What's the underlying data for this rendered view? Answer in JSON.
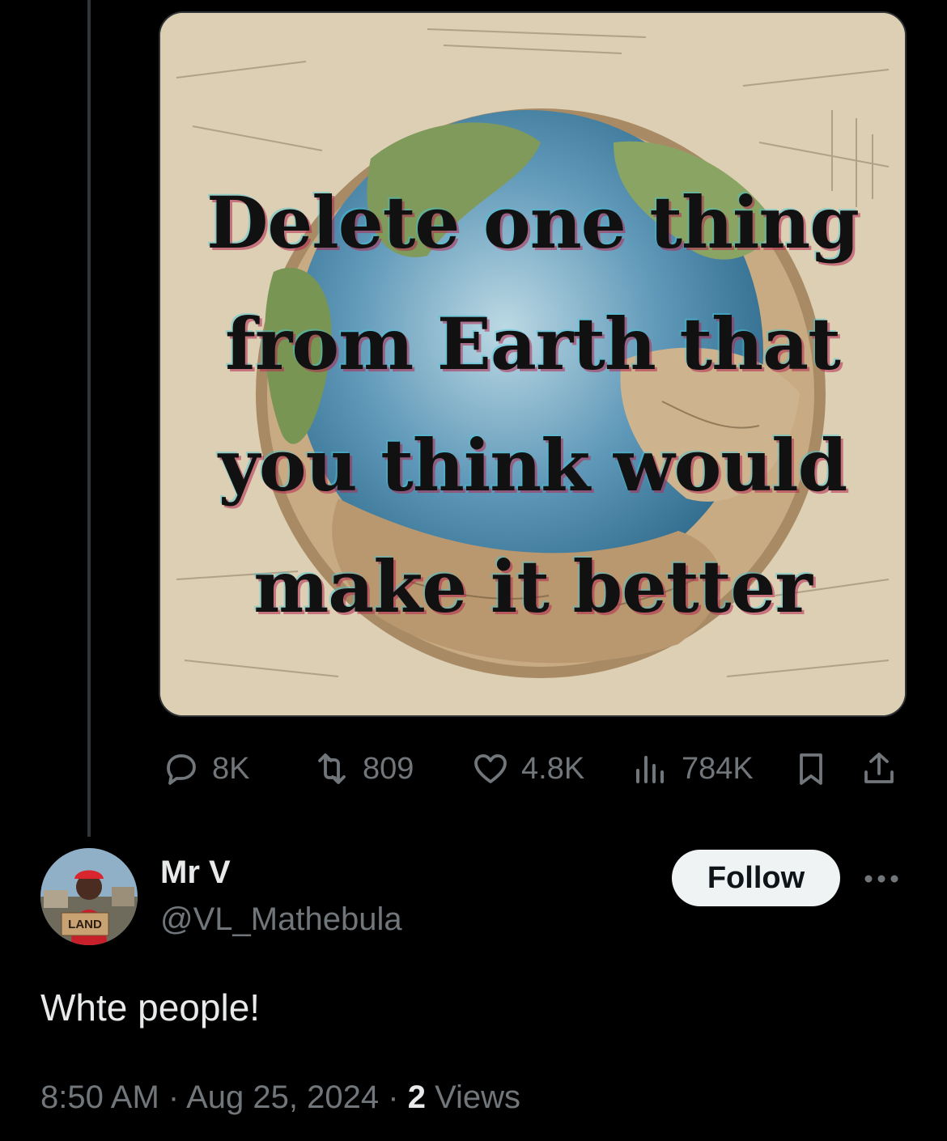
{
  "meme": {
    "lines": [
      "Delete one thing",
      "from Earth that",
      "you think would",
      "make it better"
    ]
  },
  "actions": {
    "replies": "8K",
    "reposts": "809",
    "likes": "4.8K",
    "views": "784K",
    "icons": [
      "reply-icon",
      "repost-icon",
      "like-icon",
      "views-icon",
      "bookmark-icon",
      "share-icon"
    ]
  },
  "author": {
    "name": "Mr V",
    "handle": "@VL_Mathebula",
    "follow_label": "Follow",
    "avatar_sign": "LAND"
  },
  "tweet": {
    "text": "Whte people!"
  },
  "meta": {
    "time": "8:50 AM",
    "date": "Aug 25, 2024",
    "sep": "·",
    "views_count": "2",
    "views_label": "Views"
  },
  "colors": {
    "background": "#000000",
    "text_primary": "#e7e9ea",
    "text_secondary": "#71767b",
    "follow_bg": "#eff3f4"
  }
}
